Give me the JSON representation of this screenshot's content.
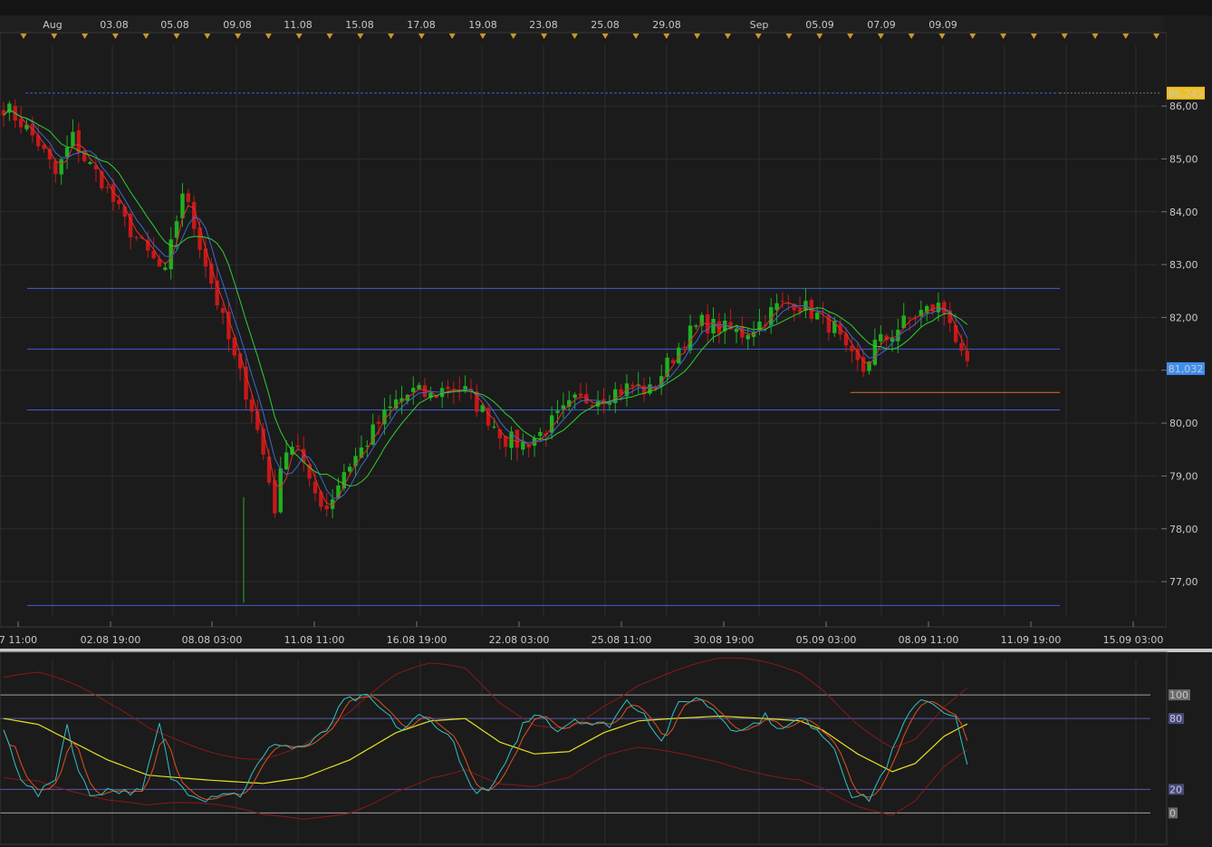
{
  "chart_data": [
    {
      "type": "candlestick",
      "panel": "price",
      "top_date_ticks": [
        "Aug",
        "03.08",
        "05.08",
        "09.08",
        "11.08",
        "15.08",
        "17.08",
        "19.08",
        "23.08",
        "25.08",
        "29.08",
        "Sep",
        "05.09",
        "07.09",
        "09.09"
      ],
      "x_ticks": [
        "7 11:00",
        "02.08 19:00",
        "08.08 03:00",
        "11.08 11:00",
        "16.08 19:00",
        "22.08 03:00",
        "25.08 11:00",
        "30.08 19:00",
        "05.09 03:00",
        "08.09 11:00",
        "11.09 19:00",
        "15.09 03:00"
      ],
      "y_ticks": [
        "86,00",
        "85,00",
        "84,00",
        "83,00",
        "82,00",
        "81,00",
        "80,00",
        "79,00",
        "78,00",
        "77,00"
      ],
      "ylim": [
        76.35,
        87.15
      ],
      "price_labels": [
        {
          "text": "86,245",
          "value": 86.245,
          "color": "#f0c020"
        },
        {
          "text": "81,032",
          "value": 81.032,
          "color": "#3f8ef0"
        }
      ],
      "horizontal_lines": [
        {
          "value": 86.245,
          "color": "#3a5fd0",
          "style": "dashed"
        },
        {
          "value": 82.55,
          "color": "#3a5fd0",
          "style": "solid"
        },
        {
          "value": 81.4,
          "color": "#3a5fd0",
          "style": "solid"
        },
        {
          "value": 80.25,
          "color": "#3a5fd0",
          "style": "solid"
        },
        {
          "value": 80.58,
          "color": "#e07020",
          "style": "solid",
          "from": 0.806
        },
        {
          "value": 76.55,
          "color": "#3a5fd0",
          "style": "solid"
        }
      ],
      "close_keypoints": [
        [
          0,
          86.0
        ],
        [
          3,
          85.7
        ],
        [
          6,
          85.3
        ],
        [
          9,
          84.7
        ],
        [
          12,
          85.4
        ],
        [
          14,
          85.0
        ],
        [
          17,
          84.6
        ],
        [
          21,
          83.8
        ],
        [
          25,
          83.2
        ],
        [
          28,
          82.8
        ],
        [
          31,
          84.4
        ],
        [
          34,
          83.4
        ],
        [
          37,
          82.3
        ],
        [
          40,
          81.2
        ],
        [
          43,
          80.3
        ],
        [
          45,
          79.4
        ],
        [
          47,
          78.4
        ],
        [
          49,
          79.6
        ],
        [
          51,
          79.6
        ],
        [
          53,
          78.8
        ],
        [
          56,
          78.4
        ],
        [
          59,
          79.1
        ],
        [
          62,
          79.5
        ],
        [
          65,
          80.0
        ],
        [
          68,
          80.4
        ],
        [
          71,
          80.6
        ],
        [
          74,
          80.5
        ],
        [
          77,
          80.7
        ],
        [
          80,
          80.6
        ],
        [
          84,
          80.1
        ],
        [
          87,
          79.7
        ],
        [
          90,
          79.6
        ],
        [
          93,
          79.8
        ],
        [
          96,
          80.1
        ],
        [
          99,
          80.4
        ],
        [
          103,
          80.5
        ],
        [
          106,
          80.6
        ],
        [
          109,
          80.7
        ],
        [
          112,
          80.6
        ],
        [
          115,
          81.1
        ],
        [
          118,
          81.6
        ],
        [
          121,
          81.9
        ],
        [
          124,
          81.8
        ],
        [
          128,
          81.7
        ],
        [
          131,
          81.9
        ],
        [
          134,
          82.2
        ],
        [
          137,
          82.3
        ],
        [
          140,
          82.1
        ],
        [
          144,
          81.8
        ],
        [
          146,
          81.3
        ],
        [
          149,
          81.0
        ],
        [
          151,
          81.5
        ],
        [
          153,
          81.6
        ],
        [
          156,
          81.9
        ],
        [
          159,
          82.1
        ],
        [
          162,
          82.2
        ],
        [
          164,
          82.0
        ],
        [
          166,
          81.2
        ],
        [
          167,
          81.0
        ]
      ],
      "candle_count": 168,
      "moving_averages": [
        {
          "color": "#e03030",
          "period": 3
        },
        {
          "color": "#3a6ad0",
          "period": 5
        },
        {
          "color": "#2fd02f",
          "period": 9
        }
      ]
    },
    {
      "type": "line",
      "panel": "oscillator",
      "y_ticks": [
        "100",
        "80",
        "20",
        "0"
      ],
      "levels": [
        100,
        80,
        20,
        0
      ],
      "ylim": [
        -25,
        130
      ],
      "fast_line_color": "#30c0c8",
      "signal_color": "#e05020",
      "smooth_color": "#e8e020",
      "band_color": "#8a1818",
      "fast_keypoints": [
        [
          0,
          70
        ],
        [
          3,
          30
        ],
        [
          6,
          15
        ],
        [
          9,
          30
        ],
        [
          11,
          75
        ],
        [
          13,
          35
        ],
        [
          15,
          15
        ],
        [
          18,
          20
        ],
        [
          21,
          18
        ],
        [
          24,
          18
        ],
        [
          27,
          75
        ],
        [
          29,
          30
        ],
        [
          32,
          18
        ],
        [
          35,
          12
        ],
        [
          38,
          18
        ],
        [
          41,
          15
        ],
        [
          44,
          40
        ],
        [
          47,
          60
        ],
        [
          50,
          55
        ],
        [
          53,
          58
        ],
        [
          56,
          70
        ],
        [
          59,
          95
        ],
        [
          63,
          98
        ],
        [
          66,
          85
        ],
        [
          69,
          70
        ],
        [
          72,
          82
        ],
        [
          75,
          75
        ],
        [
          78,
          60
        ],
        [
          81,
          20
        ],
        [
          84,
          18
        ],
        [
          87,
          40
        ],
        [
          90,
          75
        ],
        [
          93,
          85
        ],
        [
          96,
          70
        ],
        [
          99,
          80
        ],
        [
          102,
          75
        ],
        [
          105,
          75
        ],
        [
          108,
          95
        ],
        [
          111,
          85
        ],
        [
          114,
          60
        ],
        [
          117,
          92
        ],
        [
          120,
          98
        ],
        [
          123,
          88
        ],
        [
          126,
          72
        ],
        [
          129,
          72
        ],
        [
          132,
          82
        ],
        [
          135,
          70
        ],
        [
          138,
          80
        ],
        [
          141,
          72
        ],
        [
          144,
          55
        ],
        [
          147,
          15
        ],
        [
          150,
          12
        ],
        [
          153,
          40
        ],
        [
          156,
          75
        ],
        [
          159,
          98
        ],
        [
          162,
          90
        ],
        [
          165,
          80
        ],
        [
          168,
          20
        ]
      ],
      "smooth_keypoints": [
        [
          0,
          80
        ],
        [
          6,
          75
        ],
        [
          12,
          60
        ],
        [
          18,
          45
        ],
        [
          25,
          32
        ],
        [
          35,
          28
        ],
        [
          45,
          25
        ],
        [
          52,
          30
        ],
        [
          60,
          45
        ],
        [
          68,
          68
        ],
        [
          74,
          78
        ],
        [
          80,
          80
        ],
        [
          86,
          60
        ],
        [
          92,
          50
        ],
        [
          98,
          52
        ],
        [
          104,
          68
        ],
        [
          110,
          78
        ],
        [
          116,
          80
        ],
        [
          124,
          82
        ],
        [
          132,
          80
        ],
        [
          138,
          78
        ],
        [
          142,
          70
        ],
        [
          148,
          50
        ],
        [
          154,
          35
        ],
        [
          158,
          42
        ],
        [
          163,
          65
        ],
        [
          168,
          78
        ]
      ]
    }
  ]
}
